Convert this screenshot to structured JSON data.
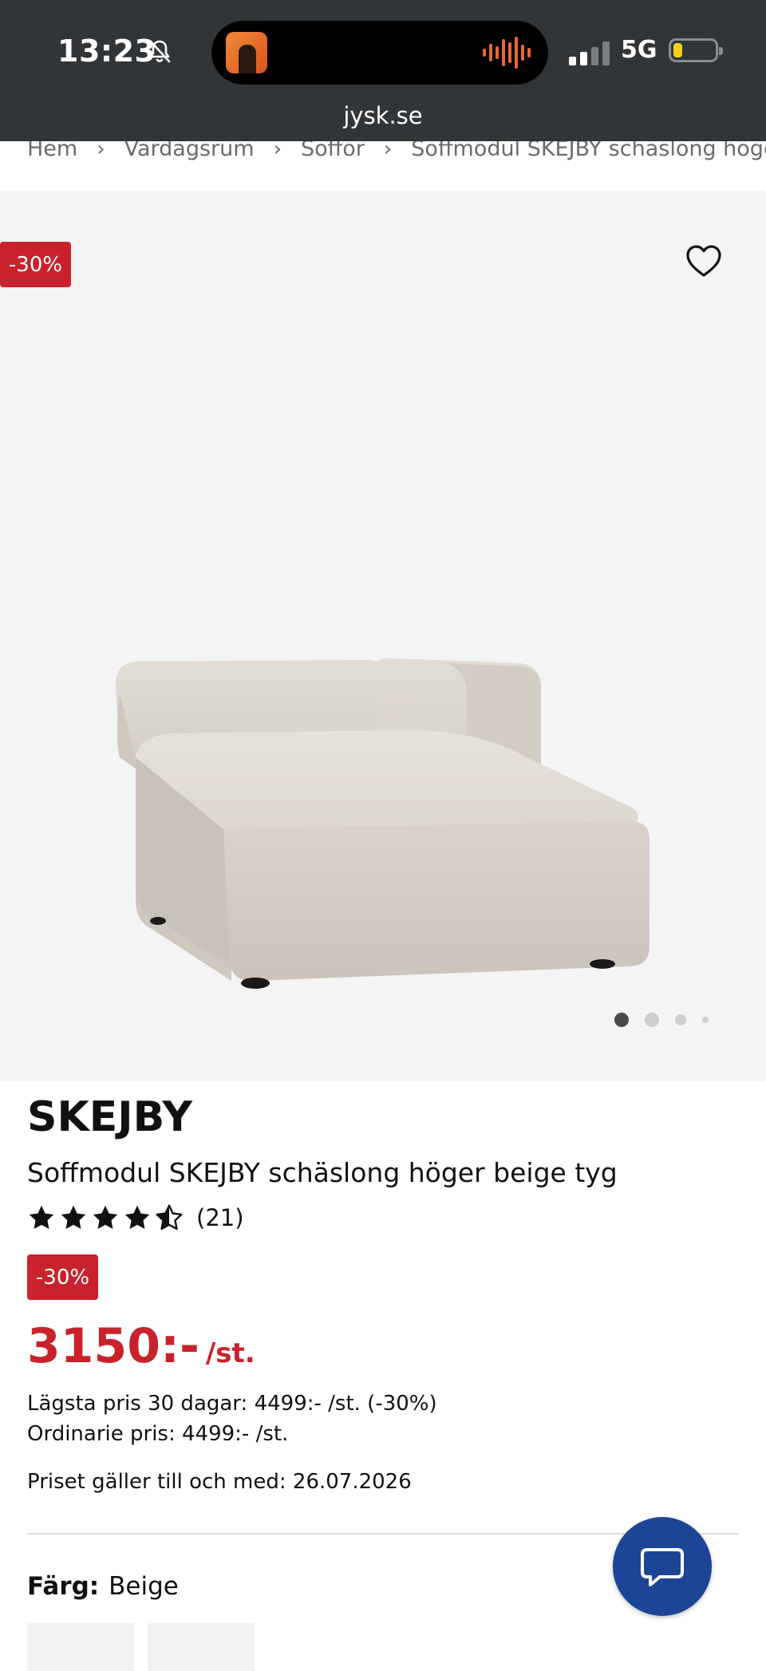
{
  "status_bar": {
    "time": "13:23",
    "network": "5G",
    "url": "jysk.se",
    "battery_level": 0.12
  },
  "breadcrumb": {
    "items": [
      "Hem",
      "Vardagsrum",
      "Soffor",
      "Soffmodul SKEJBY schäslong höger be"
    ]
  },
  "gallery": {
    "discount_badge": "-30%",
    "image_alt": "Soffmodul SKEJBY schäslong höger beige tyg",
    "slide_count": 4,
    "active_slide": 1
  },
  "product": {
    "brand": "SKEJBY",
    "title": "Soffmodul SKEJBY schäslong höger beige tyg",
    "rating": 4.5,
    "rating_max": 5,
    "review_count": "(21)",
    "discount_badge": "-30%",
    "price": "3150:-",
    "price_unit": "/st.",
    "lowest_price_30": "Lägsta pris 30 dagar: 4499:- /st. (-30%)",
    "regular_price": "Ordinarie pris: 4499:- /st.",
    "valid_until": "Priset gäller till och med: 26.07.2026",
    "color_label": "Färg:",
    "color_value": "Beige"
  },
  "colors": {
    "brand_red": "#c8232c",
    "chat_blue": "#1c4596",
    "status_bar_bg": "#323538"
  },
  "icons": {
    "wishlist": "heart-icon",
    "chat": "chat-bubble-icon",
    "breadcrumb_separator": "chevron-right-icon"
  }
}
